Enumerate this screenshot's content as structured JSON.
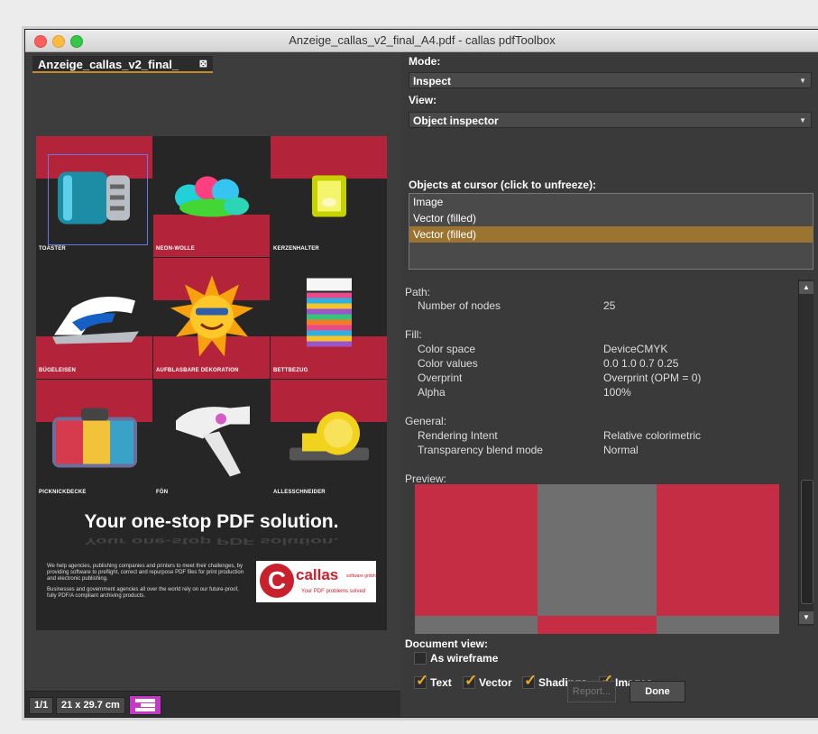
{
  "window": {
    "title": "Anzeige_callas_v2_final_A4.pdf - callas pdfToolbox"
  },
  "document": {
    "tab_label": "Anzeige_callas_v2_final_",
    "tab_close": "⊠",
    "products": [
      {
        "label": "Toaster",
        "art": "toaster"
      },
      {
        "label": "Neon-Wolle",
        "art": "yarn"
      },
      {
        "label": "Kerzenhalter",
        "art": "candle"
      },
      {
        "label": "Bügeleisen",
        "art": "iron"
      },
      {
        "label": "Aufblasbare Dekoration",
        "art": "sun"
      },
      {
        "label": "Bettbezug",
        "art": "bedding"
      },
      {
        "label": "Picknickdecke",
        "art": "blanket"
      },
      {
        "label": "Fön",
        "art": "hairdryer"
      },
      {
        "label": "Allesschneider",
        "art": "slicer"
      }
    ],
    "slogan": "Your one-stop PDF solution.",
    "blurb": [
      "We help agencies, publishing companies and printers to meet their challenges, by providing software to preflight, correct and repurpose PDF files for print production and electronic publishing.",
      "Businesses and government agencies all over the world rely on our future-proof, fully PDF/A compliant archiving products."
    ],
    "logo": {
      "mark": "C",
      "name": "callas",
      "sub": "software gmbh",
      "tagline": "Your PDF problems solved"
    }
  },
  "statusbar": {
    "page": "1/1",
    "size": "21 x 29.7 cm"
  },
  "panel": {
    "mode_label": "Mode:",
    "mode_value": "Inspect",
    "view_label": "View:",
    "view_value": "Object inspector",
    "objects_label": "Objects at cursor (click to unfreeze):",
    "objects": [
      {
        "label": "Image",
        "selected": false
      },
      {
        "label": "Vector (filled)",
        "selected": false
      },
      {
        "label": "Vector (filled)",
        "selected": true
      }
    ],
    "path_heading": "Path:",
    "path_rows": [
      {
        "key": "Number of nodes",
        "value": "25"
      }
    ],
    "fill_heading": "Fill:",
    "fill_rows": [
      {
        "key": "Color space",
        "value": "DeviceCMYK"
      },
      {
        "key": "Color values",
        "value": "0.0  1.0  0.7  0.25"
      },
      {
        "key": "Overprint",
        "value": "Overprint (OPM = 0)"
      },
      {
        "key": "Alpha",
        "value": "100%"
      }
    ],
    "general_heading": "General:",
    "general_rows": [
      {
        "key": "Rendering Intent",
        "value": "Relative colorimetric"
      },
      {
        "key": "Transparency blend mode",
        "value": "Normal"
      }
    ],
    "preview_label": "Preview:",
    "preview_colors": {
      "red": "#c52d45",
      "gray": "#6f6f6f"
    },
    "docview_label": "Document view:",
    "wireframe_label": "As wireframe",
    "filters": [
      {
        "label": "Text",
        "checked": true
      },
      {
        "label": "Vector",
        "checked": true
      },
      {
        "label": "Shadings",
        "checked": true
      },
      {
        "label": "Images",
        "checked": true
      }
    ],
    "report_button": "Report...",
    "done_button": "Done"
  }
}
